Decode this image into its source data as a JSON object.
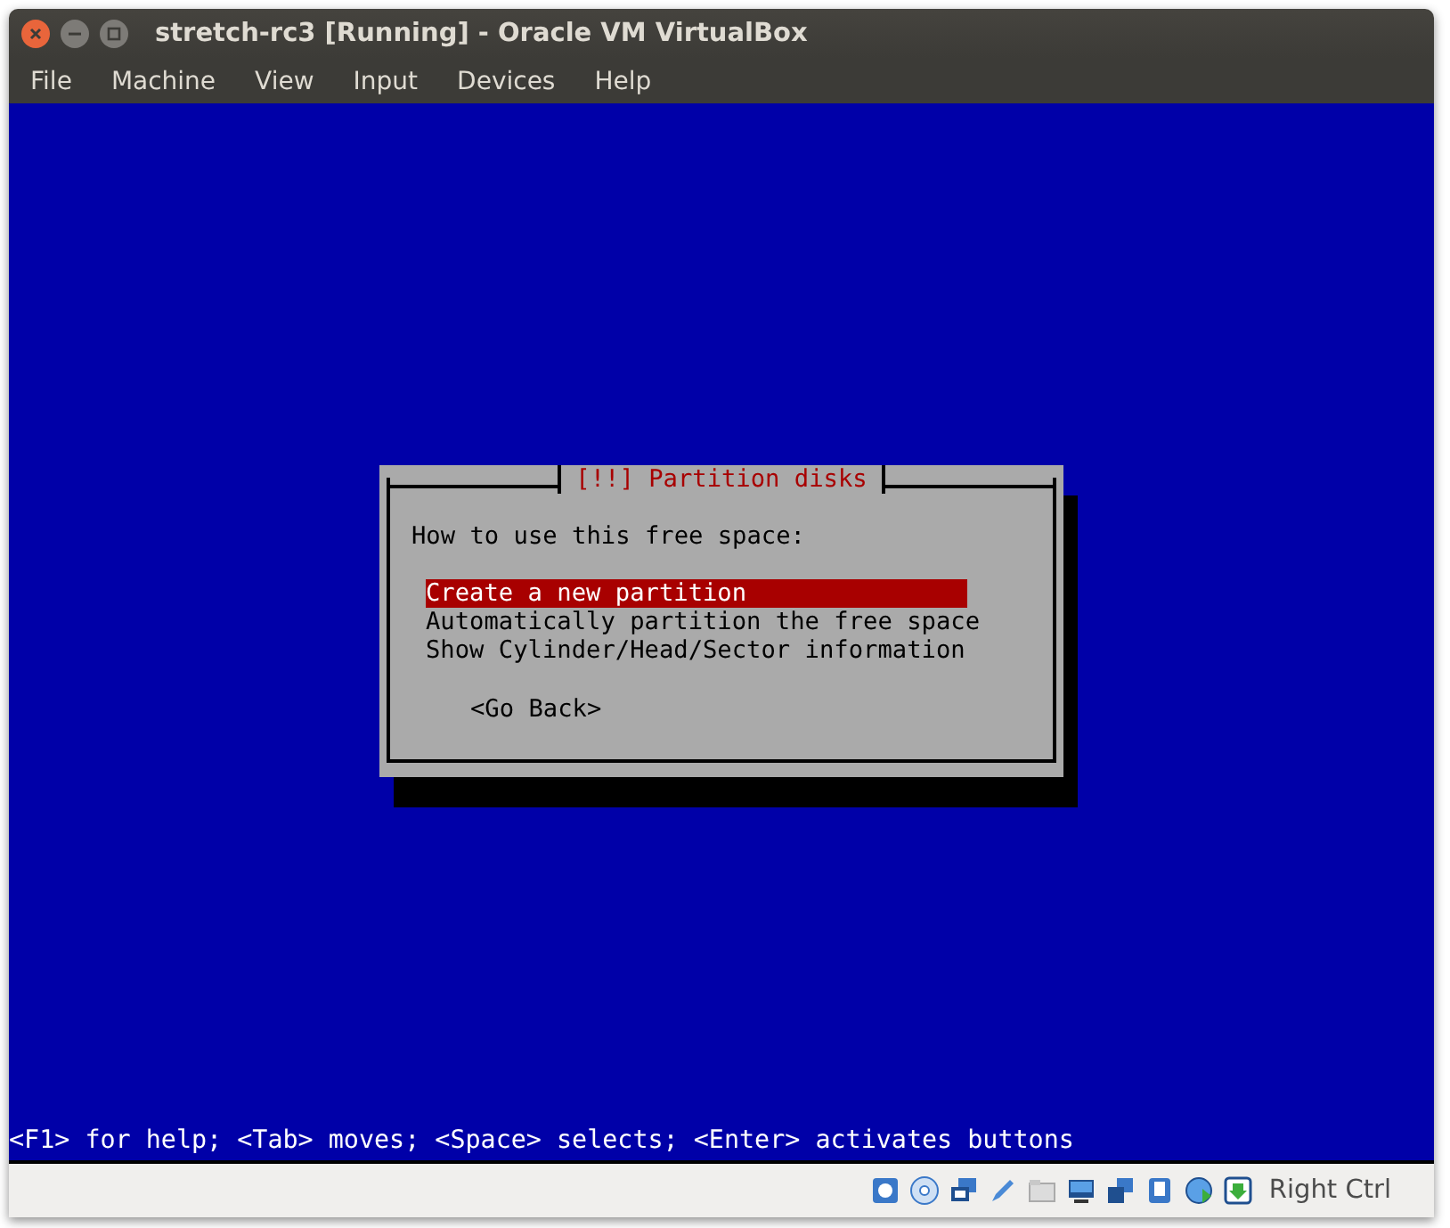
{
  "window": {
    "title": "stretch-rc3 [Running] - Oracle VM VirtualBox"
  },
  "menu": [
    "File",
    "Machine",
    "View",
    "Input",
    "Devices",
    "Help"
  ],
  "dialog": {
    "title": "[!!] Partition disks",
    "prompt": "How to use this free space:",
    "options": [
      {
        "label": "Create a new partition",
        "selected": true
      },
      {
        "label": "Automatically partition the free space",
        "selected": false
      },
      {
        "label": "Show Cylinder/Head/Sector information",
        "selected": false
      }
    ],
    "button": "<Go Back>"
  },
  "help_line": "<F1> for help; <Tab> moves; <Space> selects; <Enter> activates buttons",
  "status_bar": {
    "host_key": "Right Ctrl"
  }
}
